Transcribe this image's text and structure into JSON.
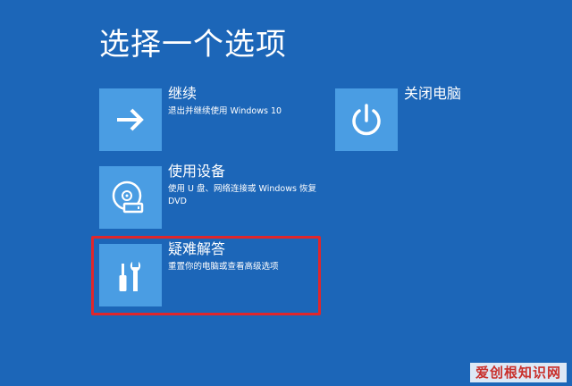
{
  "screen": {
    "title": "选择一个选项",
    "background": "#1c66b8",
    "tile_color": "#4a9de3",
    "highlight_color": "#e0262b"
  },
  "options": {
    "continue": {
      "title": "继续",
      "description": "退出并继续使用 Windows 10",
      "icon": "arrow-right-icon"
    },
    "use_device": {
      "title": "使用设备",
      "description": "使用 U 盘、网络连接或 Windows 恢复 DVD",
      "icon": "disc-drive-icon"
    },
    "troubleshoot": {
      "title": "疑难解答",
      "description": "重置你的电脑或查看高级选项",
      "icon": "tools-icon"
    },
    "shutdown": {
      "title": "关闭电脑",
      "icon": "power-icon"
    }
  },
  "watermark": {
    "text": "爱创根知识网"
  }
}
